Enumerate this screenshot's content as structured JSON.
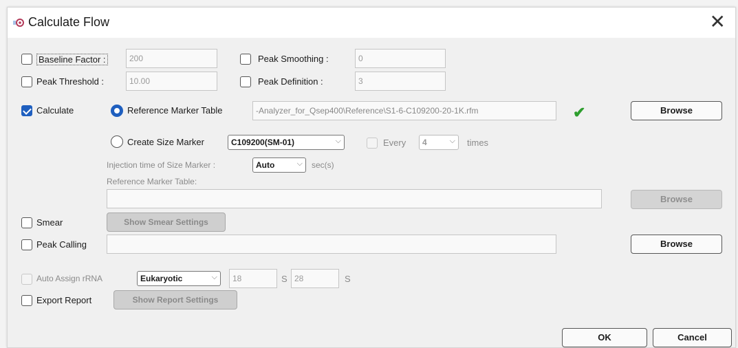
{
  "window": {
    "title": "Calculate Flow",
    "close_glyph": "✕"
  },
  "peak_params": {
    "baseline_factor": {
      "label": "Baseline Factor :",
      "value": "200",
      "checked": false
    },
    "peak_threshold": {
      "label": "Peak Threshold :",
      "value": "10.00",
      "checked": false
    },
    "peak_smoothing": {
      "label": "Peak Smoothing :",
      "value": "0",
      "checked": false
    },
    "peak_definition": {
      "label": "Peak Definition :",
      "value": "3",
      "checked": false
    }
  },
  "calculate": {
    "label": "Calculate",
    "checked": true,
    "ref_marker_radio_label": "Reference Marker Table",
    "ref_marker_path": "-Analyzer_for_Qsep400\\Reference\\S1-6-C109200-20-1K.rfm",
    "browse_label": "Browse",
    "create_size_marker_label": "Create Size Marker",
    "size_marker_option": "C109200(SM-01)",
    "every_label": "Every",
    "every_value": "4",
    "times_label": "times",
    "injection_label": "Injection time of Size Marker :",
    "injection_option": "Auto",
    "sec_label": "sec(s)",
    "ref_table_label": "Reference Marker Table:",
    "ref_table_value": "",
    "browse2_label": "Browse"
  },
  "smear": {
    "label": "Smear",
    "settings_button": "Show Smear Settings"
  },
  "peak_calling": {
    "label": "Peak Calling",
    "value": "",
    "browse_label": "Browse"
  },
  "auto_assign": {
    "label": "Auto Assign rRNA",
    "option": "Eukaryotic",
    "value1": "18",
    "unit1": "S",
    "value2": "28",
    "unit2": "S"
  },
  "export_report": {
    "label": "Export Report",
    "settings_button": "Show Report Settings"
  },
  "footer": {
    "ok_label": "OK",
    "cancel_label": "Cancel"
  },
  "colors": {
    "accent": "#1f5fbf",
    "check_green": "#2e9e2e"
  }
}
